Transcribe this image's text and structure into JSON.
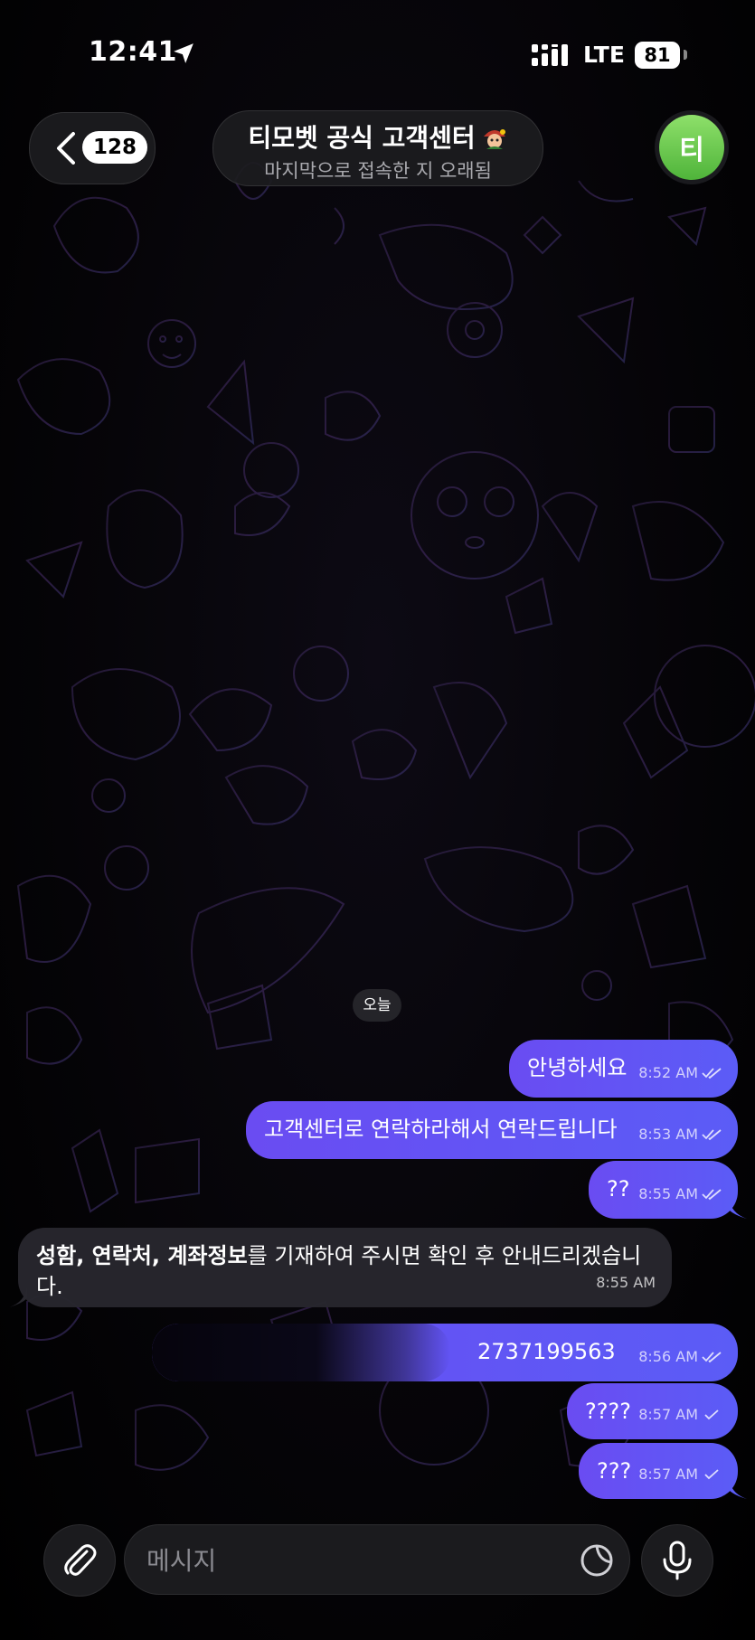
{
  "status_bar": {
    "time": "12:41",
    "network": "LTE",
    "battery": "81"
  },
  "header": {
    "unread_count": "128",
    "title": "티모벳 공식 고객센터",
    "subtitle": "마지막으로 접속한 지 오래됨",
    "avatar_initial": "티"
  },
  "chat": {
    "date_separator": "오늘",
    "messages": [
      {
        "direction": "out",
        "text": "안녕하세요",
        "time": "8:52 AM",
        "status": "read"
      },
      {
        "direction": "out",
        "text": "고객센터로 연락하라해서 연락드립니다",
        "time": "8:53 AM",
        "status": "read"
      },
      {
        "direction": "out",
        "text": "??",
        "time": "8:55 AM",
        "status": "read"
      },
      {
        "direction": "in",
        "bold_part": "성함, 연락처, 계좌정보",
        "text": "를 기재하여 주시면 확인 후 안내드리겠습니다.",
        "time": "8:55 AM"
      },
      {
        "direction": "out",
        "text": "2737199563",
        "time": "8:56 AM",
        "status": "read"
      },
      {
        "direction": "out",
        "text": "????",
        "time": "8:57 AM",
        "status": "sent"
      },
      {
        "direction": "out",
        "text": "???",
        "time": "8:57 AM",
        "status": "sent"
      }
    ]
  },
  "composer": {
    "placeholder": "메시지"
  },
  "colors": {
    "outgoing_bubble": "#6a4cf2",
    "incoming_bubble": "#28272e",
    "avatar": "#5cbf44"
  }
}
